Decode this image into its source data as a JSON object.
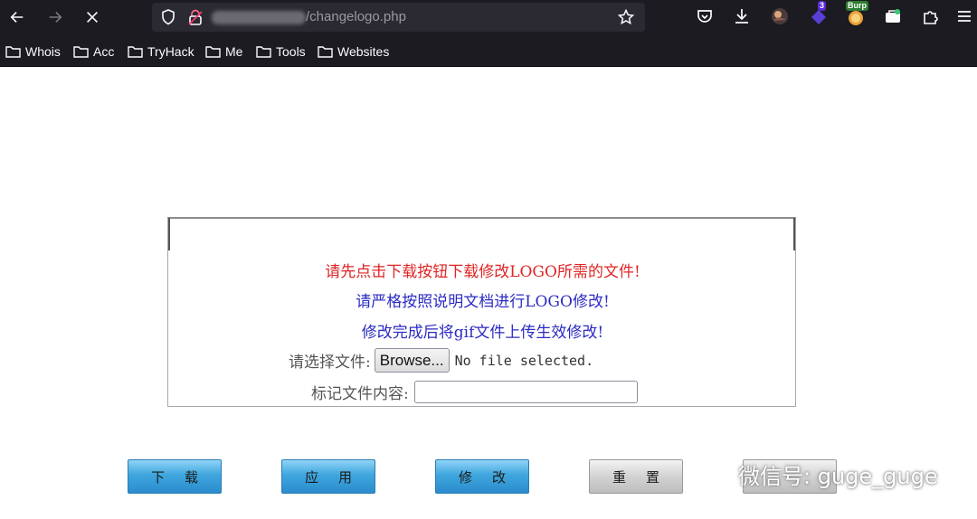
{
  "browser": {
    "url_suffix": "/changelogo.php",
    "extensions": [
      {
        "name": "pocket-icon"
      },
      {
        "name": "download-icon"
      },
      {
        "name": "profile-avatar-icon"
      },
      {
        "name": "extension-badge-icon",
        "badge": "3"
      },
      {
        "name": "burp-icon",
        "badge": "Burp"
      },
      {
        "name": "container-icon"
      },
      {
        "name": "extensions-puzzle-icon"
      },
      {
        "name": "menu-icon"
      }
    ]
  },
  "bookmarks": [
    {
      "label": "Whois"
    },
    {
      "label": "Acc"
    },
    {
      "label": "TryHack"
    },
    {
      "label": "Me"
    },
    {
      "label": "Tools"
    },
    {
      "label": "Websites"
    }
  ],
  "form": {
    "notice_red": "请先点击下载按钮下载修改LOGO所需的文件!",
    "notice_blue_1": "请严格按照说明文档进行LOGO修改!",
    "notice_blue_2": "修改完成后将gif文件上传生效修改!",
    "file_label": "请选择文件:",
    "browse_label": "Browse...",
    "file_status": "No file selected.",
    "mark_label": "标记文件内容:",
    "mark_value": ""
  },
  "actions": {
    "download": "下载",
    "apply": "应用",
    "modify": "修改",
    "reset": "重置"
  },
  "watermark": "微信号: guge_guge",
  "colors": {
    "red": "#e02424",
    "blue": "#2b2bc4",
    "button_blue": "#3fa6dd"
  }
}
